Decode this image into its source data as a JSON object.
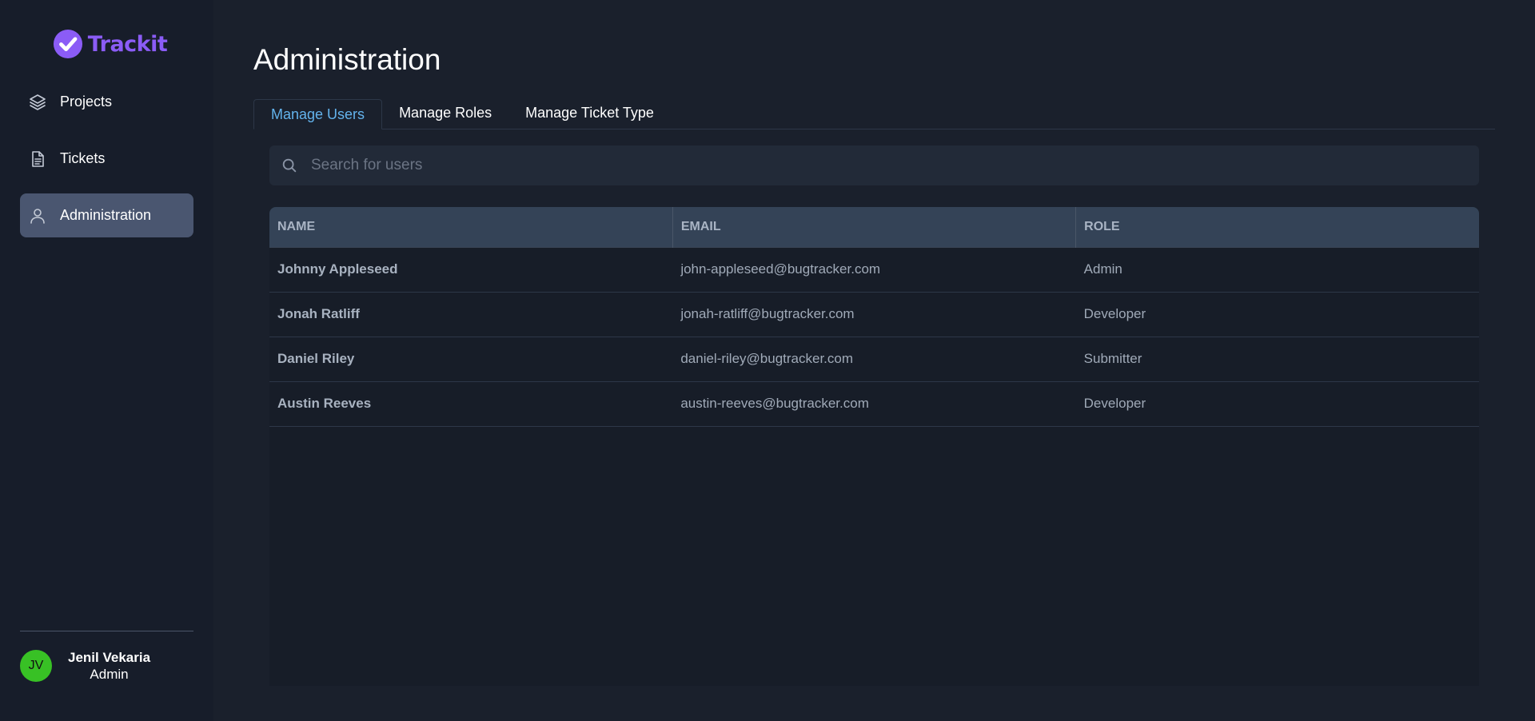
{
  "brand": {
    "name": "Trackit",
    "color": "#8b5cf6"
  },
  "sidebar": {
    "items": [
      {
        "label": "Projects",
        "icon": "layers-icon",
        "active": false
      },
      {
        "label": "Tickets",
        "icon": "document-icon",
        "active": false
      },
      {
        "label": "Administration",
        "icon": "user-icon",
        "active": true
      }
    ]
  },
  "user": {
    "initials": "JV",
    "name": "Jenil Vekaria",
    "role": "Admin",
    "avatar_color": "#38c125"
  },
  "page": {
    "title": "Administration"
  },
  "tabs": [
    {
      "label": "Manage Users",
      "active": true
    },
    {
      "label": "Manage Roles",
      "active": false
    },
    {
      "label": "Manage Ticket Type",
      "active": false
    }
  ],
  "search": {
    "placeholder": "Search for users",
    "value": ""
  },
  "table": {
    "headers": [
      "NAME",
      "EMAIL",
      "ROLE"
    ],
    "rows": [
      {
        "name": "Johnny Appleseed",
        "email": "john-appleseed@bugtracker.com",
        "role": "Admin"
      },
      {
        "name": "Jonah Ratliff",
        "email": "jonah-ratliff@bugtracker.com",
        "role": "Developer"
      },
      {
        "name": "Daniel Riley",
        "email": "daniel-riley@bugtracker.com",
        "role": "Submitter"
      },
      {
        "name": "Austin Reeves",
        "email": "austin-reeves@bugtracker.com",
        "role": "Developer"
      }
    ]
  }
}
